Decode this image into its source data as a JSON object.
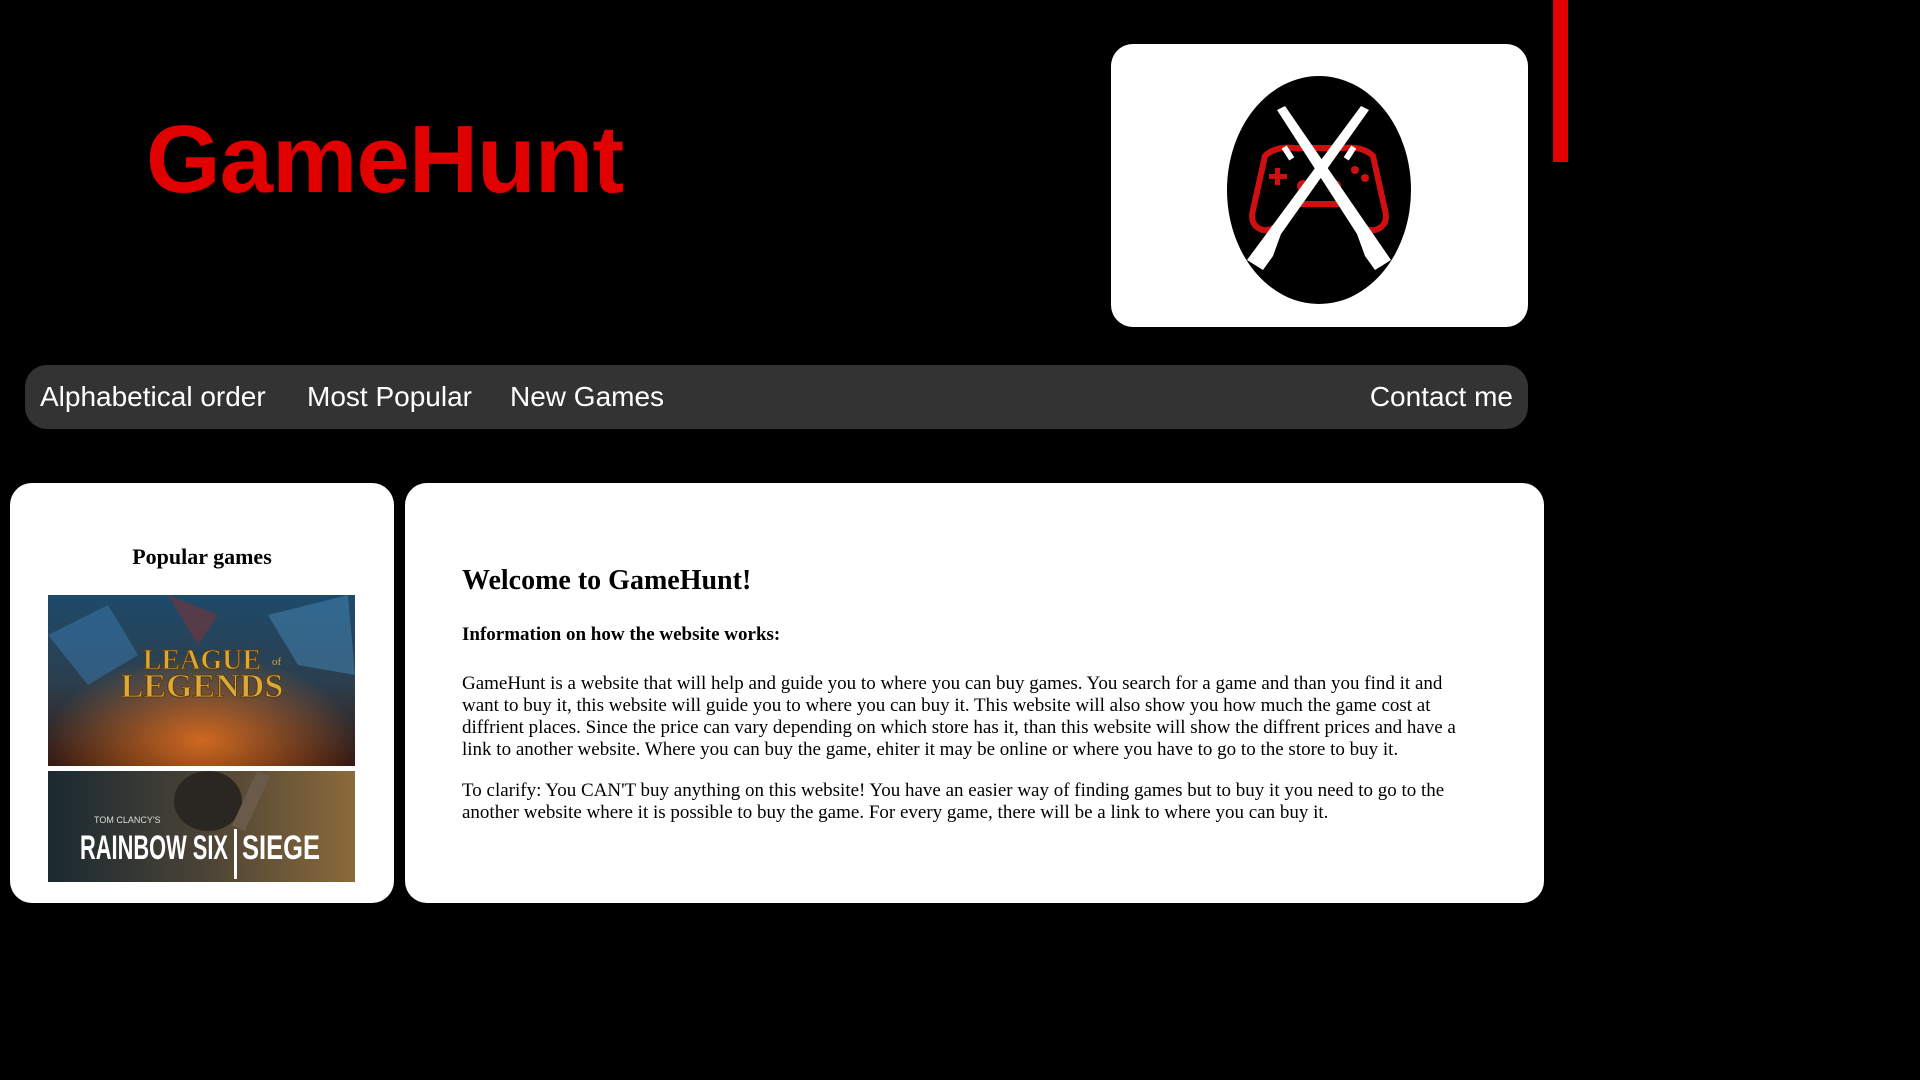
{
  "header": {
    "site_title": "GameHunt",
    "logo_icon": "crossed-rifles-controller-logo",
    "accent_color": "#e00000"
  },
  "nav": {
    "items": [
      {
        "label": "Alphabetical order"
      },
      {
        "label": "Most Popular"
      },
      {
        "label": "New Games"
      }
    ],
    "contact_label": "Contact me"
  },
  "sidebar": {
    "heading": "Popular games",
    "games": [
      {
        "logo_text_1": "LEAGUE",
        "logo_text_small": "of",
        "logo_text_2": "LEGENDS"
      },
      {
        "logo_text_brand": "TOM CLANCY'S",
        "logo_text_1": "RAINBOW SIX",
        "logo_text_2": "SIEGE"
      }
    ]
  },
  "main": {
    "welcome_title": "Welcome to GameHunt!",
    "info_heading": "Information on how the website works:",
    "paragraphs": [
      "GameHunt is a website that will help and guide you to where you can buy games. You search for a game and than you find it and want to buy it, this website will guide you to where you can buy it. This website will also show you how much the game cost at diffrient places. Since the price can vary depending on which store has it, than this website will show the diffrent prices and have a link to another website. Where you can buy the game, ehiter it may be online or where you have to go to the store to buy it.",
      "To clarify: You CAN'T buy anything on this website! You have an easier way of finding games but to buy it you need to go to the another website where it is possible to buy the game. For every game, there will be a link to where you can buy it."
    ]
  }
}
